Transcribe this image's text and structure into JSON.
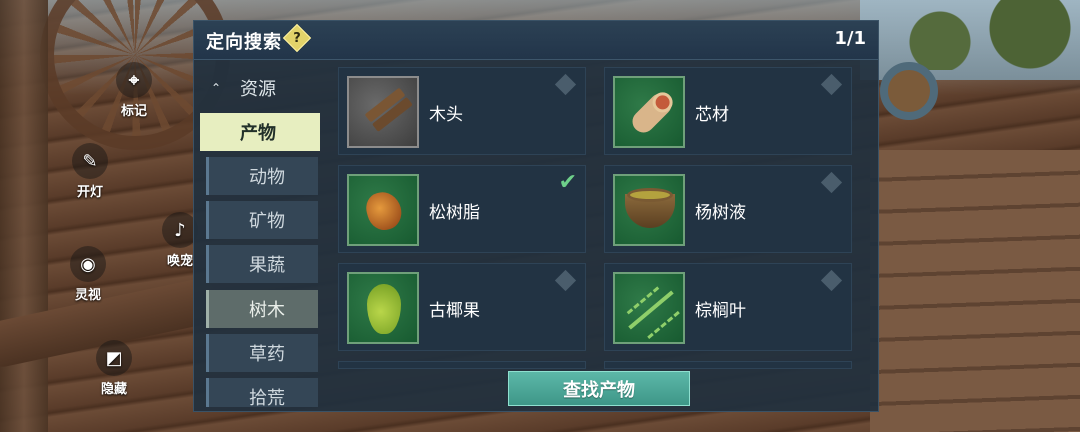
{
  "hud": {
    "mark_label": "标记",
    "light_label": "开灯",
    "spirit_label": "灵视",
    "hide_label": "隐藏",
    "whistle_label": "唤宠"
  },
  "panel": {
    "title": "定向搜索",
    "help_glyph": "?",
    "page_indicator": "1/1"
  },
  "categories": {
    "parent": "资源",
    "items": [
      "产物",
      "动物",
      "矿物",
      "果蔬",
      "树木",
      "草药",
      "拾荒"
    ]
  },
  "grid": {
    "items": [
      {
        "name": "木头",
        "icon": "wood-icon",
        "checked": false
      },
      {
        "name": "芯材",
        "icon": "heartwood-icon",
        "checked": false
      },
      {
        "name": "松树脂",
        "icon": "pine-resin-icon",
        "checked": true
      },
      {
        "name": "杨树液",
        "icon": "poplar-sap-icon",
        "checked": false
      },
      {
        "name": "古椰果",
        "icon": "ancient-coconut-icon",
        "checked": false
      },
      {
        "name": "棕榈叶",
        "icon": "palm-leaf-icon",
        "checked": false
      }
    ]
  },
  "footer": {
    "find_button_label": "查找产物"
  },
  "colors": {
    "selected_category": "#e7eec0",
    "active_category": "#5e6c6a",
    "find_button": "#4fa898",
    "check": "#6ed08a"
  }
}
